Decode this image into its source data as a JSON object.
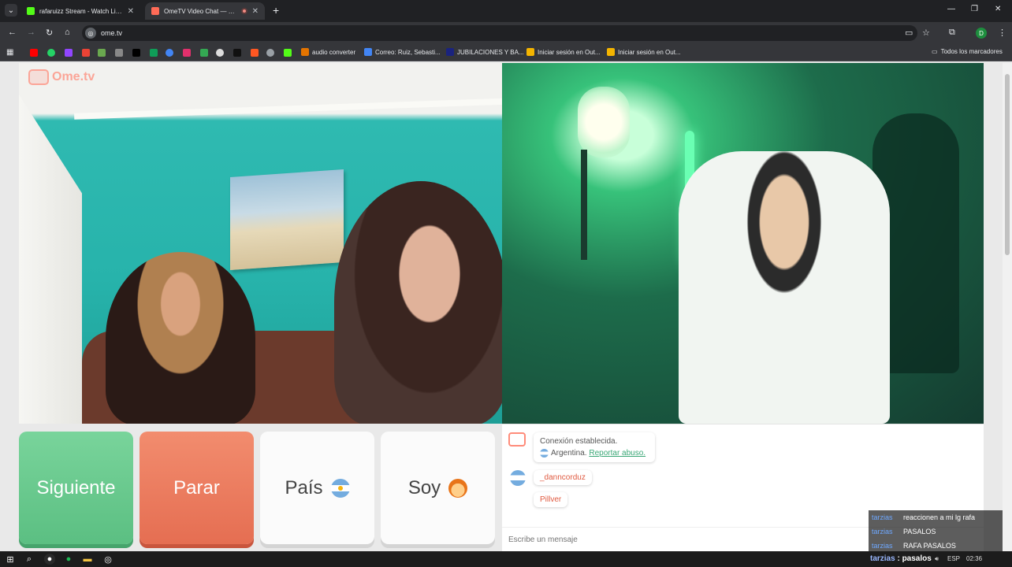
{
  "browser": {
    "tabs": [
      {
        "title": "rafaruizz Stream - Watch Live o",
        "favicon_color": "#53fc18"
      },
      {
        "title": "OmeTV Video Chat — Ome",
        "favicon_color": "#ff6b57"
      }
    ],
    "url": "ome.tv",
    "profile_initial": "D",
    "bookmarks": [
      {
        "label": "audio converter",
        "color": "#e37400"
      },
      {
        "label": "Correo: Ruiz, Sebasti...",
        "color": "#4285f4"
      },
      {
        "label": "JUBILACIONES Y BA...",
        "color": "#1a237e"
      },
      {
        "label": "Iniciar sesión en Out...",
        "color": "#f4b400"
      },
      {
        "label": "Iniciar sesión en Out...",
        "color": "#f4b400"
      }
    ],
    "all_bookmarks": "Todos los marcadores"
  },
  "app": {
    "logo": "Ome.tv",
    "buttons": {
      "next": "Siguiente",
      "stop": "Parar",
      "country": "País",
      "gender": "Soy"
    },
    "chat": {
      "system_line1": "Conexión establecida.",
      "system_country": "Argentina.",
      "report_link": "Reportar abuso.",
      "messages": [
        "_danncorduz",
        "Pillver"
      ],
      "input_placeholder": "Escribe un mensaje"
    }
  },
  "overlay": {
    "rows": [
      {
        "user": "tarzias",
        "msg": "reaccionen a mi lg rafa"
      },
      {
        "user": "tarzias",
        "msg": "PASALOS"
      },
      {
        "user": "tarzias",
        "msg": "RAFA PASALOS"
      }
    ]
  },
  "taskbar": {
    "caption_user": "tarzias",
    "caption_msg": "pasalos",
    "lang": "ESP",
    "time": "02:36"
  },
  "colors": {
    "next": "#5bbf82",
    "stop": "#e56e52",
    "accent": "#ff8c7a"
  }
}
